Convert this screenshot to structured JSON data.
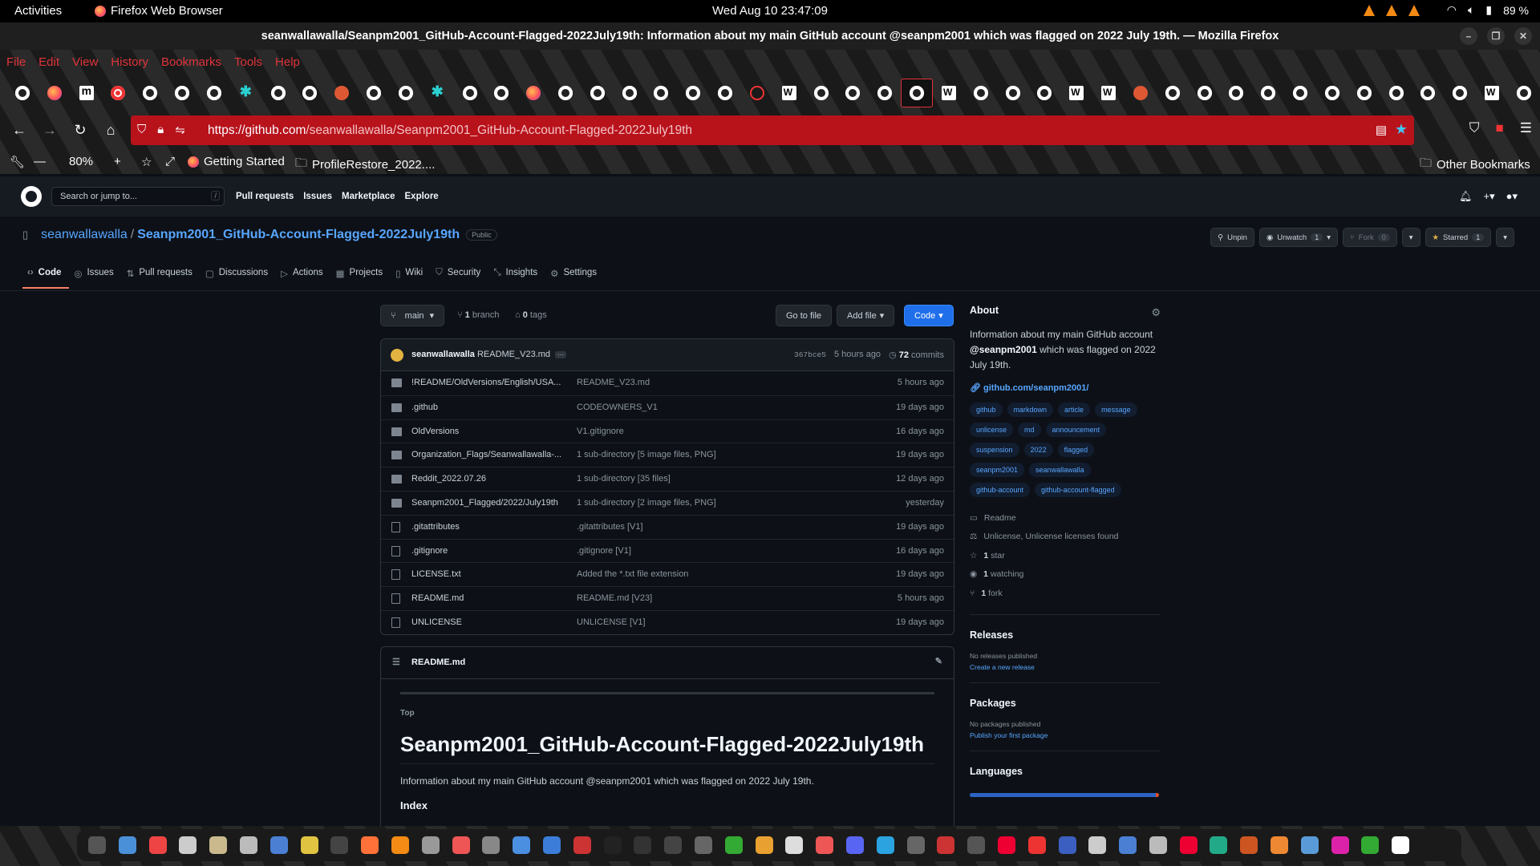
{
  "gnome": {
    "activities": "Activities",
    "app_name": "Firefox Web Browser",
    "clock": "Wed Aug 10  23:47:09",
    "battery": "89 %"
  },
  "window": {
    "title": "seanwallawalla/Seanpm2001_GitHub-Account-Flagged-2022July19th: Information about my main GitHub account @seanpm2001 which was flagged on 2022 July 19th. — Mozilla Firefox"
  },
  "menubar": [
    "File",
    "Edit",
    "View",
    "History",
    "Bookmarks",
    "Tools",
    "Help"
  ],
  "tab_favicons": [
    "gh",
    "ff",
    "m",
    "red",
    "gh",
    "gh",
    "gh",
    "cy",
    "gh",
    "gh",
    "ddg",
    "gh",
    "gh",
    "cy",
    "gh",
    "gh",
    "ff",
    "gh",
    "gh",
    "gh",
    "gh",
    "gh",
    "gh",
    "globe",
    "w",
    "gh",
    "gh",
    "gh",
    "gh",
    "w",
    "gh",
    "gh",
    "gh",
    "w",
    "w",
    "ddg",
    "gh",
    "gh",
    "gh",
    "gh",
    "gh",
    "gh",
    "gh",
    "gh",
    "gh",
    "gh",
    "w",
    "gh"
  ],
  "active_tab_index": 28,
  "url": {
    "scheme": "https://",
    "host": "github.com",
    "path": "/seanwallawalla/Seanpm2001_GitHub-Account-Flagged-2022July19th"
  },
  "bookmarks": {
    "zoom": "80%",
    "getting_started": "Getting Started",
    "folder": "ProfileRestore_2022....",
    "other": "Other Bookmarks"
  },
  "github": {
    "search_placeholder": "Search or jump to...",
    "search_key": "/",
    "nav": [
      "Pull requests",
      "Issues",
      "Marketplace",
      "Explore"
    ],
    "owner": "seanwallawalla",
    "repo": "Seanpm2001_GitHub-Account-Flagged-2022July19th",
    "visibility": "Public",
    "actions": {
      "unpin": "Unpin",
      "unwatch": "Unwatch",
      "watch_count": "1",
      "fork": "Fork",
      "fork_count": "0",
      "starred": "Starred",
      "star_count": "1"
    },
    "tabs": [
      "Code",
      "Issues",
      "Pull requests",
      "Discussions",
      "Actions",
      "Projects",
      "Wiki",
      "Security",
      "Insights",
      "Settings"
    ],
    "branch": "main",
    "branch_count": "1",
    "branch_label": "branch",
    "tag_count": "0",
    "tag_label": "tags",
    "go_to_file": "Go to file",
    "add_file": "Add file",
    "code_btn": "Code",
    "commit": {
      "author": "seanwallawalla",
      "message": "README_V23.md",
      "sha": "367bce5",
      "age": "5 hours ago",
      "count": "72",
      "count_label": "commits"
    },
    "files": [
      {
        "type": "dir",
        "name": "!README/OldVersions/English/USA...",
        "msg": "README_V23.md",
        "age": "5 hours ago"
      },
      {
        "type": "dir",
        "name": ".github",
        "msg": "CODEOWNERS_V1",
        "age": "19 days ago"
      },
      {
        "type": "dir",
        "name": "OldVersions",
        "msg": "V1.gitignore",
        "age": "16 days ago"
      },
      {
        "type": "dir",
        "name": "Organization_Flags/Seanwallawalla-...",
        "msg": "1 sub-directory [5 image files, PNG]",
        "age": "19 days ago"
      },
      {
        "type": "dir",
        "name": "Reddit_2022.07.26",
        "msg": "1 sub-directory [35 files]",
        "age": "12 days ago"
      },
      {
        "type": "dir",
        "name": "Seanpm2001_Flagged/2022/July19th",
        "msg": "1 sub-directory [2 image files, PNG]",
        "age": "yesterday"
      },
      {
        "type": "file",
        "name": ".gitattributes",
        "msg": ".gitattributes [V1]",
        "age": "19 days ago"
      },
      {
        "type": "file",
        "name": ".gitignore",
        "msg": ".gitignore [V1]",
        "age": "16 days ago"
      },
      {
        "type": "file",
        "name": "LICENSE.txt",
        "msg": "Added the *.txt file extension",
        "age": "19 days ago"
      },
      {
        "type": "file",
        "name": "README.md",
        "msg": "README.md [V23]",
        "age": "5 hours ago"
      },
      {
        "type": "file",
        "name": "UNLICENSE",
        "msg": "UNLICENSE [V1]",
        "age": "19 days ago"
      }
    ],
    "readme": {
      "filename": "README.md",
      "top": "Top",
      "heading": "Seanpm2001_GitHub-Account-Flagged-2022July19th",
      "para": "Information about my main GitHub account @seanpm2001 which was flagged on 2022 July 19th.",
      "index": "Index"
    },
    "about": {
      "title": "About",
      "desc_pre": "Information about my main GitHub account ",
      "desc_user": "@seanpm2001",
      "desc_post": " which was flagged on 2022 July 19th.",
      "link": "github.com/seanpm2001/",
      "topics": [
        "github",
        "markdown",
        "article",
        "message",
        "unlicense",
        "md",
        "announcement",
        "suspension",
        "2022",
        "flagged",
        "seanpm2001",
        "seanwallawalla",
        "github-account",
        "github-account-flagged"
      ],
      "readme": "Readme",
      "license": "Unlicense, Unlicense licenses found",
      "stars_n": "1",
      "stars": "star",
      "watching_n": "1",
      "watching": "watching",
      "forks_n": "1",
      "forks": "fork",
      "releases": "Releases",
      "no_releases": "No releases published",
      "create_release": "Create a new release",
      "packages": "Packages",
      "no_packages": "No packages published",
      "publish_package": "Publish your first package",
      "languages": "Languages"
    }
  },
  "dock_colors": [
    "#555",
    "#4a90d9",
    "#e44",
    "#ccc",
    "#c9b98d",
    "#bbb",
    "#4a7fd4",
    "#e0c341",
    "#444",
    "#ff7139",
    "#f38b15",
    "#999",
    "#e55",
    "#888",
    "#4a8fe0",
    "#3b7dd8",
    "#c33",
    "#222",
    "#333",
    "#444",
    "#666",
    "#3a3",
    "#e8a030",
    "#ddd",
    "#e55",
    "#5865f2",
    "#2aa3e0",
    "#666",
    "#c33",
    "#555",
    "#e03",
    "#e33",
    "#3b5fc0",
    "#ccc",
    "#4a7fd4",
    "#bbb",
    "#e03",
    "#2a8",
    "#c52",
    "#e83",
    "#5a9ad8",
    "#d2a",
    "#3a3",
    "#fff"
  ]
}
